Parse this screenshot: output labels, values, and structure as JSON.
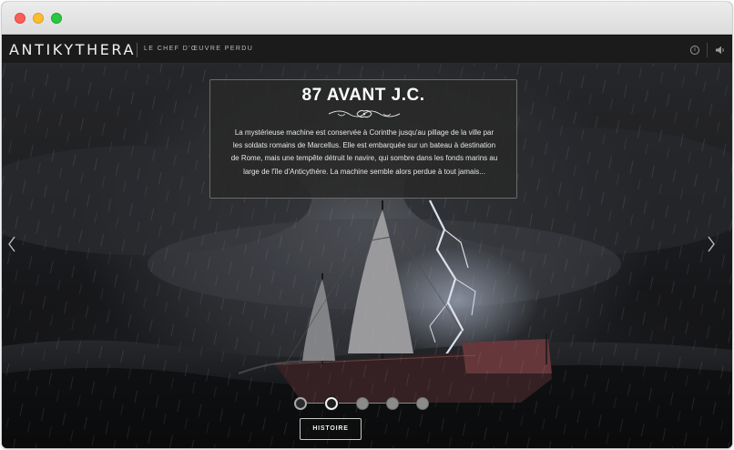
{
  "header": {
    "logo": "ANTIKYTHERA",
    "tagline": "LE CHEF D'ŒUVRE PERDU",
    "info_icon_glyph": "i"
  },
  "icons": {
    "info": "info-icon",
    "sound": "speaker-icon",
    "prev": "chevron-left-icon",
    "next": "chevron-right-icon",
    "ornament": "flourish-ornament-icon"
  },
  "infobox": {
    "title": "87 AVANT J.C.",
    "text": "La mystérieuse machine est conservée à Corinthe jusqu'au pillage de la ville par les soldats romains de Marcellus. Elle est embarquée sur un bateau à destination de Rome, mais une tempête détruit le navire, qui sombre dans les fonds marins au large de l'île d'Anticythère. La machine semble alors perdue à tout jamais..."
  },
  "timeline": {
    "steps": 5,
    "current_step": 2
  },
  "histoire_button": "HISTOIRE",
  "colors": {
    "appbar": "#1b1b1b",
    "close": "#fc5f57",
    "minimize": "#fdbc2e",
    "maximize": "#28c840"
  }
}
